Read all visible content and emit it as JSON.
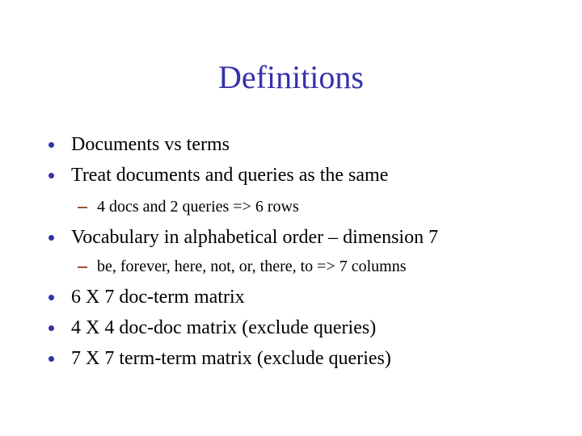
{
  "slide": {
    "title": "Definitions",
    "colors": {
      "title": "#3333aa",
      "bullet": "#3333aa",
      "dash": "#a0522d",
      "text": "#000000",
      "background": "#ffffff"
    },
    "bullets": [
      {
        "level": 1,
        "marker": "bullet-dot",
        "text": "Documents vs terms"
      },
      {
        "level": 1,
        "marker": "bullet-dot",
        "text": "Treat documents and queries as the same"
      },
      {
        "level": 2,
        "marker": "en-dash",
        "text": "4 docs and 2 queries => 6 rows"
      },
      {
        "level": 1,
        "marker": "bullet-dot",
        "text": "Vocabulary in alphabetical order – dimension 7"
      },
      {
        "level": 2,
        "marker": "en-dash",
        "text": "be, forever, here, not, or, there, to => 7 columns"
      },
      {
        "level": 1,
        "marker": "bullet-dot",
        "text": "6 X 7 doc-term matrix"
      },
      {
        "level": 1,
        "marker": "bullet-dot",
        "text": "4 X 4 doc-doc matrix (exclude queries)"
      },
      {
        "level": 1,
        "marker": "bullet-dot",
        "text": "7 X 7 term-term matrix (exclude queries)"
      }
    ]
  }
}
